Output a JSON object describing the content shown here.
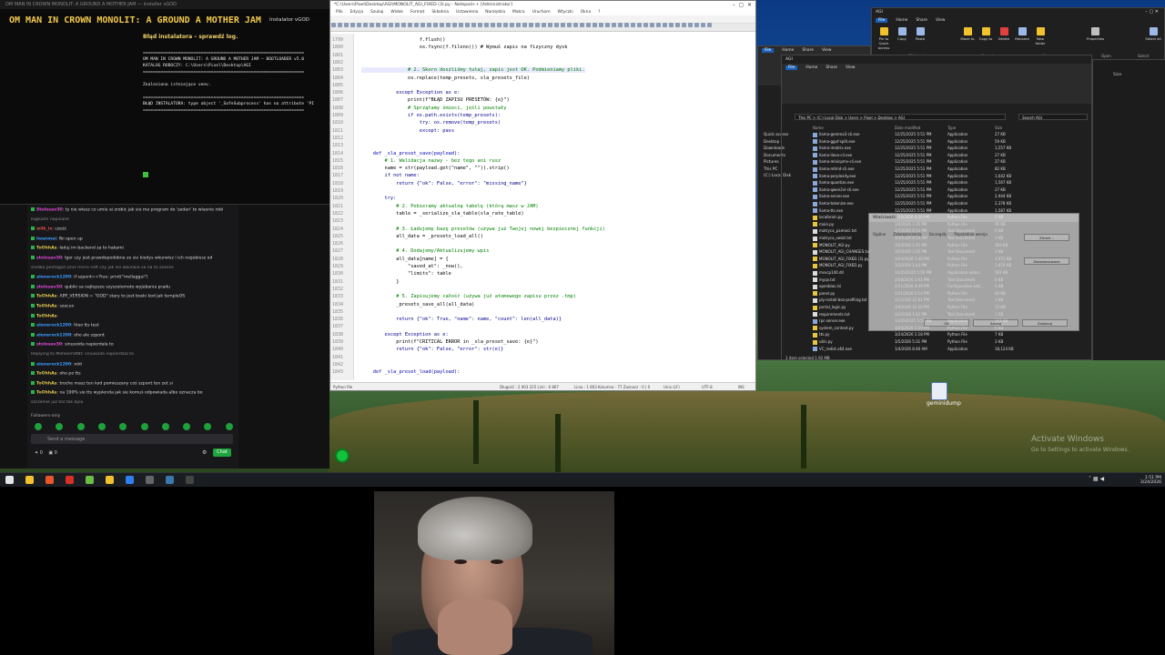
{
  "installer": {
    "window_title": "OM MAN IN CROWN MONOLIT: A GROUND A MOTHER JAM — Installer vGOD",
    "heading": "OM MAN IN CROWN MONOLIT: A GROUND A MOTHER JAM",
    "version_label": "Instalator vGOD",
    "error_title": "Błąd instalatora – sprawdź log.",
    "log_lines": [
      "================================================================",
      "OM MAN IN CROWN MONOLIT: A GROUND A MOTHER JAM – BOOTLOADER v5.0",
      "KATALOG ROBOCZY: C:\\Users\\Pixel\\Desktop\\AGI",
      "================================================================",
      "",
      "Znaleziono istniejące venv.",
      "",
      "================================================================",
      "BŁĄD INSTALATORA: type object '_SafeSubprocess' has no attribute 'PI",
      "================================================================"
    ]
  },
  "chat": {
    "messages": [
      {
        "user": "Stolosav30",
        "text": "ty nie wiesz co umie ai zrobic jak sie ma program do 'zadan' to wlasnie robi",
        "color": "#e04ad9"
      },
      {
        "user": "",
        "text": "logikami napisane",
        "color": "#e04ad9"
      },
      {
        "user": "wilk_ix",
        "text": "cześć",
        "color": "#e04a4a"
      },
      {
        "user": "Iwanmai",
        "text": "fbi open up",
        "color": "#3b9bff"
      },
      {
        "user": "ToOhhAs",
        "text": "ładuj im backend za to hakami",
        "color": "#e0c84a"
      },
      {
        "user": "stolosav30",
        "text": "Igor czy jest prawdopodobne ze sie kiedys wkurwisz i ich rozjebiesz od",
        "color": "#e04ad9"
      },
      {
        "user": "",
        "text": "srodka pentagon plus micro soft czy jak sie wkurwia sa na to szanse",
        "color": "#e04ad9"
      },
      {
        "user": "alenerock1200",
        "text": "if szpont==True: print(\"mellaggul\")",
        "color": "#3b9bff"
      },
      {
        "user": "stolosav30",
        "text": "qubiki sa najlepsze szyszelemoto wyjebania pradu",
        "color": "#e04ad9"
      },
      {
        "user": "ToOhhAs",
        "text": "APP_VERSION = \"GOD\" stary to jest boski kod jak templeOS",
        "color": "#e0c84a"
      },
      {
        "user": "ToOhhAs",
        "text": "szacun",
        "color": "#e0c84a"
      },
      {
        "user": "ToOhhAs",
        "text": "",
        "color": "#e0c84a"
      },
      {
        "user": "alenerock1200",
        "text": "hlao tts test",
        "color": "#3b9bff"
      },
      {
        "user": "alenerock1200",
        "text": "oho ale szpont",
        "color": "#3b9bff"
      },
      {
        "user": "stolosav30",
        "text": "sinusoida napierdala to",
        "color": "#e04ad9"
      },
      {
        "user": "",
        "text": "Replying to Mohkemdt8t: sinusoida napierdala to",
        "color": "#888888"
      },
      {
        "user": "alenerock1200",
        "text": "xdd",
        "color": "#3b9bff"
      },
      {
        "user": "ToOhhAs",
        "text": "oho po tts",
        "color": "#e0c84a"
      },
      {
        "user": "ToOhhAs",
        "text": "troche masz ten kod pomieszany coś szpont ten zet si",
        "color": "#e0c84a"
      },
      {
        "user": "ToOhhAs",
        "text": "na 100% sie tts wyplenda jak sie komuś odpowiada albo oznacza bo",
        "color": "#e0c84a"
      },
      {
        "user": "",
        "text": "szczelnie juz tez tak bylo",
        "color": "#e0c84a"
      }
    ],
    "followers_note": "Followers-only",
    "input_placeholder": "Send a message",
    "points": "0",
    "viewers": "0",
    "chat_button": "Chat"
  },
  "notepad": {
    "title": "*C:\\Users\\Pixel\\Desktop\\AGI\\MONOLIT_AGI_FIXED (3).py - Notepad++ [Administrator]",
    "menu": [
      "Plik",
      "Edycja",
      "Szukaj",
      "Widok",
      "Format",
      "Składnia",
      "Ustawienia",
      "Narzędzia",
      "Makra",
      "Uruchom",
      "Wtyczki",
      "Okna",
      "?"
    ],
    "tabs": [
      "AGI_monolit_godmode.py",
      "CORTEX_FIXED.py",
      "MONOLIT_FINAL.py",
      "AGI_NAPRAW_DUZA.py",
      "MONOLIT_AGI_FIXED (3).py",
      "MONOLIT_AGI_FIXED.py"
    ],
    "active_tab": "MONOLIT_AGI_FIXED (3).py",
    "lines": [
      {
        "n": "1799",
        "code": "                    f.flush()"
      },
      {
        "n": "1800",
        "code": "                    os.fsync(f.fileno()) # Wymuś zapis na fizyczny dysk"
      },
      {
        "n": "1801",
        "code": ""
      },
      {
        "n": "1802",
        "code": ""
      },
      {
        "n": "1803",
        "code": "                # 2. Skoro doszliśmy tutaj, zapis jest OK. Podmieniamy pliki."
      },
      {
        "n": "1804",
        "code": "                os.replace(temp_presets, sla_presets_file)"
      },
      {
        "n": "1805",
        "code": ""
      },
      {
        "n": "1806",
        "code": "            except Exception as e:"
      },
      {
        "n": "1807",
        "code": "                print(f\"BŁĄD ZAPISU PRESETÓW: {e}\")"
      },
      {
        "n": "1808",
        "code": "                # Sprzątamy śmieci, jeśli powstały"
      },
      {
        "n": "1809",
        "code": "                if os.path.exists(temp_presets):"
      },
      {
        "n": "1810",
        "code": "                    try: os.remove(temp_presets)"
      },
      {
        "n": "1811",
        "code": "                    except: pass"
      },
      {
        "n": "1812",
        "code": ""
      },
      {
        "n": "1813",
        "code": ""
      },
      {
        "n": "1814",
        "code": "    def _sla_preset_save(payload):"
      },
      {
        "n": "1815",
        "code": "        # 1. Walidacja nazwy - bez tego ani rusz"
      },
      {
        "n": "1816",
        "code": "        name = str(payload.get(\"name\", \"\")).strip()"
      },
      {
        "n": "1817",
        "code": "        if not name:"
      },
      {
        "n": "1818",
        "code": "            return {\"ok\": False, \"error\": \"missing_name\"}"
      },
      {
        "n": "1819",
        "code": ""
      },
      {
        "n": "1820",
        "code": "        try:"
      },
      {
        "n": "1821",
        "code": "            # 2. Pobieramy aktualną tabelę (którą masz w JAM)"
      },
      {
        "n": "1822",
        "code": "            table = _serialize_sla_table(sla_rate_table)"
      },
      {
        "n": "1823",
        "code": ""
      },
      {
        "n": "1824",
        "code": "            # 3. Ładujemy bazę presetów (używa już Twojej nowej bezpiecznej funkcji)"
      },
      {
        "n": "1825",
        "code": "            all_data = _presets_load_all()"
      },
      {
        "n": "1826",
        "code": ""
      },
      {
        "n": "1827",
        "code": "            # 4. Dodajemy/Aktualizujemy wpis"
      },
      {
        "n": "1828",
        "code": "            all_data[name] = {"
      },
      {
        "n": "1829",
        "code": "                \"saved_at\": _now(),"
      },
      {
        "n": "1830",
        "code": "                \"limits\": table"
      },
      {
        "n": "1831",
        "code": "            }"
      },
      {
        "n": "1832",
        "code": ""
      },
      {
        "n": "1833",
        "code": "            # 5. Zapisujemy całość (używa już atomowego zapisu przez .tmp)"
      },
      {
        "n": "1834",
        "code": "            _presets_save_all(all_data)"
      },
      {
        "n": "1835",
        "code": ""
      },
      {
        "n": "1836",
        "code": "            return {\"ok\": True, \"name\": name, \"count\": len(all_data)}"
      },
      {
        "n": "1837",
        "code": ""
      },
      {
        "n": "1838",
        "code": "        except Exception as e:"
      },
      {
        "n": "1839",
        "code": "            print(f\"CRITICAL ERROR in _sla_preset_save: {e}\")"
      },
      {
        "n": "1840",
        "code": "            return {\"ok\": False, \"error\": str(e)}"
      },
      {
        "n": "1841",
        "code": ""
      },
      {
        "n": "1842",
        "code": ""
      },
      {
        "n": "1843",
        "code": "    def _sla_preset_load(payload):"
      }
    ],
    "status": {
      "lang": "Python file",
      "length": "Długość : 2 003 225    Linii : 6 867",
      "position": "Linia : 1 803    Kolumna : 77    Zaznacz : 0 | 0",
      "eol": "Unix (LF)",
      "enc": "UTF-8",
      "mode": "INS"
    }
  },
  "explorer_main": {
    "title": "AGI",
    "ribbon_tabs": [
      "File",
      "Home",
      "Share",
      "View"
    ],
    "breadcrumb": "This PC  >  (C:) Local Disk  >  Users  >  Pixel  >  Desktop  >  AGI",
    "search_placeholder": "Search AGI",
    "nav": [
      "Quick access",
      "Desktop",
      "Downloads",
      "Documents",
      "Pictures",
      "This PC",
      "(C:) Local Disk",
      "(D:)",
      "(E:)"
    ],
    "headers": [
      "Name",
      "Date modified",
      "Type",
      "Size"
    ],
    "files": [
      [
        "llama-gemma3-cli.exe",
        "12/25/2025 5:51 PM",
        "Application",
        "27 KB"
      ],
      [
        "llama-gguf-split.exe",
        "12/25/2025 5:51 PM",
        "Application",
        "59 KB"
      ],
      [
        "llama-imatrix.exe",
        "12/25/2025 5:51 PM",
        "Application",
        "1,557 KB"
      ],
      [
        "llama-llava-cli.exe",
        "12/25/2025 5:51 PM",
        "Application",
        "27 KB"
      ],
      [
        "llama-minicpmv-cli.exe",
        "12/25/2025 5:51 PM",
        "Application",
        "27 KB"
      ],
      [
        "llama-mtmd-cli.exe",
        "12/25/2025 5:51 PM",
        "Application",
        "82 KB"
      ],
      [
        "llama-perplexity.exe",
        "12/25/2025 5:51 PM",
        "Application",
        "1,642 KB"
      ],
      [
        "llama-quantize.exe",
        "12/25/2025 5:51 PM",
        "Application",
        "1,567 KB"
      ],
      [
        "llama-qwen2vl-cli.exe",
        "12/25/2025 5:51 PM",
        "Application",
        "27 KB"
      ],
      [
        "llama-server.exe",
        "12/25/2025 5:51 PM",
        "Application",
        "2,944 KB"
      ],
      [
        "llama-tokenize.exe",
        "12/25/2025 5:51 PM",
        "Application",
        "2,378 KB"
      ],
      [
        "llama-tts.exe",
        "12/25/2025 5:51 PM",
        "Application",
        "1,587 KB"
      ],
      [
        "localbrain.py",
        "2/26/2026 6:20 PM",
        "Python File",
        "2 KB"
      ],
      [
        "main.py",
        "3/4/2026 1:35 PM",
        "Python File",
        "95 KB"
      ],
      [
        "matryca_pamieci.txt",
        "2/7/2026 8:24 PM",
        "Text Document",
        "0 KB"
      ],
      [
        "matryca_swiat.txt",
        "3/2/2026 8:14 AM",
        "Text Document",
        "3 KB"
      ],
      [
        "MONOLIT_AGI.py",
        "3/2/2026 1:41 PM",
        "Python File",
        "283 KB"
      ],
      [
        "MONOLIT_AGI_CHANGES.txt",
        "3/2/2026 3:35 PM",
        "Text Document",
        "2 KB"
      ],
      [
        "MONOLIT_AGI_FIXED (3).py",
        "3/24/2026 1:49 PM",
        "Python File",
        "1,971 KB"
      ],
      [
        "MONOLIT_AGI_FIXED.py",
        "3/3/2026 1:43 PM",
        "Python File",
        "1,874 KB"
      ],
      [
        "msvcp140.dll",
        "12/25/2025 5:50 PM",
        "Application exten...",
        "562 KB"
      ],
      [
        "myqv.txt",
        "2/28/2026 3:41 PM",
        "Text Document",
        "0 KB"
      ],
      [
        "openblas.ini",
        "2/21/2026 4:49 PM",
        "Configuration sett...",
        "1 KB"
      ],
      [
        "panel.py",
        "2/21/2026 2:14 PM",
        "Python File",
        "40 KB"
      ],
      [
        "ply-install-bez-profiling.txt",
        "3/1/2026 12:01 PM",
        "Text Document",
        "1 KB"
      ],
      [
        "portal_logic.py",
        "3/4/2026 12:20 PM",
        "Python File",
        "13 KB"
      ],
      [
        "requirements.txt",
        "3/3/2026 1:42 PM",
        "Text Document",
        "1 KB"
      ],
      [
        "rpc-server.exe",
        "12/25/2025 5:51 PM",
        "Application",
        "115 KB"
      ],
      [
        "system_context.py",
        "3/24/2026 1:19 PM",
        "Python File",
        "6 KB"
      ],
      [
        "tts.py",
        "3/24/2026 1:18 PM",
        "Python File",
        "7 KB"
      ],
      [
        "utils.py",
        "3/5/2026 5:31 PM",
        "Python File",
        "3 KB"
      ],
      [
        "VC_redist.x64.exe",
        "1/4/2026 8:46 AM",
        "Application",
        "18,124 KB"
      ]
    ],
    "status_bar": "1 item selected  1.92 MB"
  },
  "explorer_small": {
    "title": "AGI",
    "ribbon_tabs": [
      "File",
      "Home",
      "Share",
      "View"
    ],
    "buttons": [
      "Pin to Quick access",
      "Copy",
      "Paste",
      "Move to",
      "Copy to",
      "Delete",
      "Rename",
      "New folder",
      "Properties",
      "Select all"
    ],
    "groups": [
      "Clipboard",
      "Organize",
      "New",
      "Open",
      "Select"
    ],
    "status": "Size"
  },
  "explorer_second": {
    "title": "AGI",
    "ribbon_tabs": [
      "File",
      "Home",
      "Share",
      "View"
    ],
    "nav": [
      "Quick access",
      "Desktop",
      "Downloads",
      "Documents",
      "Pictures",
      "This PC",
      "(C:) Local Disk"
    ]
  },
  "dialog": {
    "title": "Właściwości",
    "tabs": [
      "Ogólne",
      "Zabezpieczenia",
      "Szczegóły",
      "Poprzednie wersje"
    ],
    "buttons": [
      "Zmień...",
      "Zaawansowane",
      "OK",
      "Anuluj",
      "Zastosuj"
    ]
  },
  "desktop": {
    "watermark_1": "Activate Windows",
    "watermark_2": "Go to Settings to activate Windows.",
    "icon_label": "geminidump"
  },
  "taskbar": {
    "time": "1:51 PM",
    "date": "3/24/2026",
    "icons": [
      {
        "name": "start",
        "color": "#e6e6e6"
      },
      {
        "name": "file-explorer",
        "color": "#f2c12e"
      },
      {
        "name": "brave",
        "color": "#e8562a"
      },
      {
        "name": "chrome",
        "color": "#d93025"
      },
      {
        "name": "notepad-plus-plus",
        "color": "#6bbd45"
      },
      {
        "name": "explorer-2",
        "color": "#f2c12e"
      },
      {
        "name": "vscode",
        "color": "#2f80ed"
      },
      {
        "name": "obs",
        "color": "#666666"
      },
      {
        "name": "python",
        "color": "#3b77a8"
      },
      {
        "name": "terminal",
        "color": "#444444"
      }
    ]
  },
  "colors": {
    "accent_green": "#1fa53d",
    "installer_heading": "#f2c94c",
    "active_tab_red": "#c01818",
    "file_tab_blue": "#1a5fb4"
  }
}
